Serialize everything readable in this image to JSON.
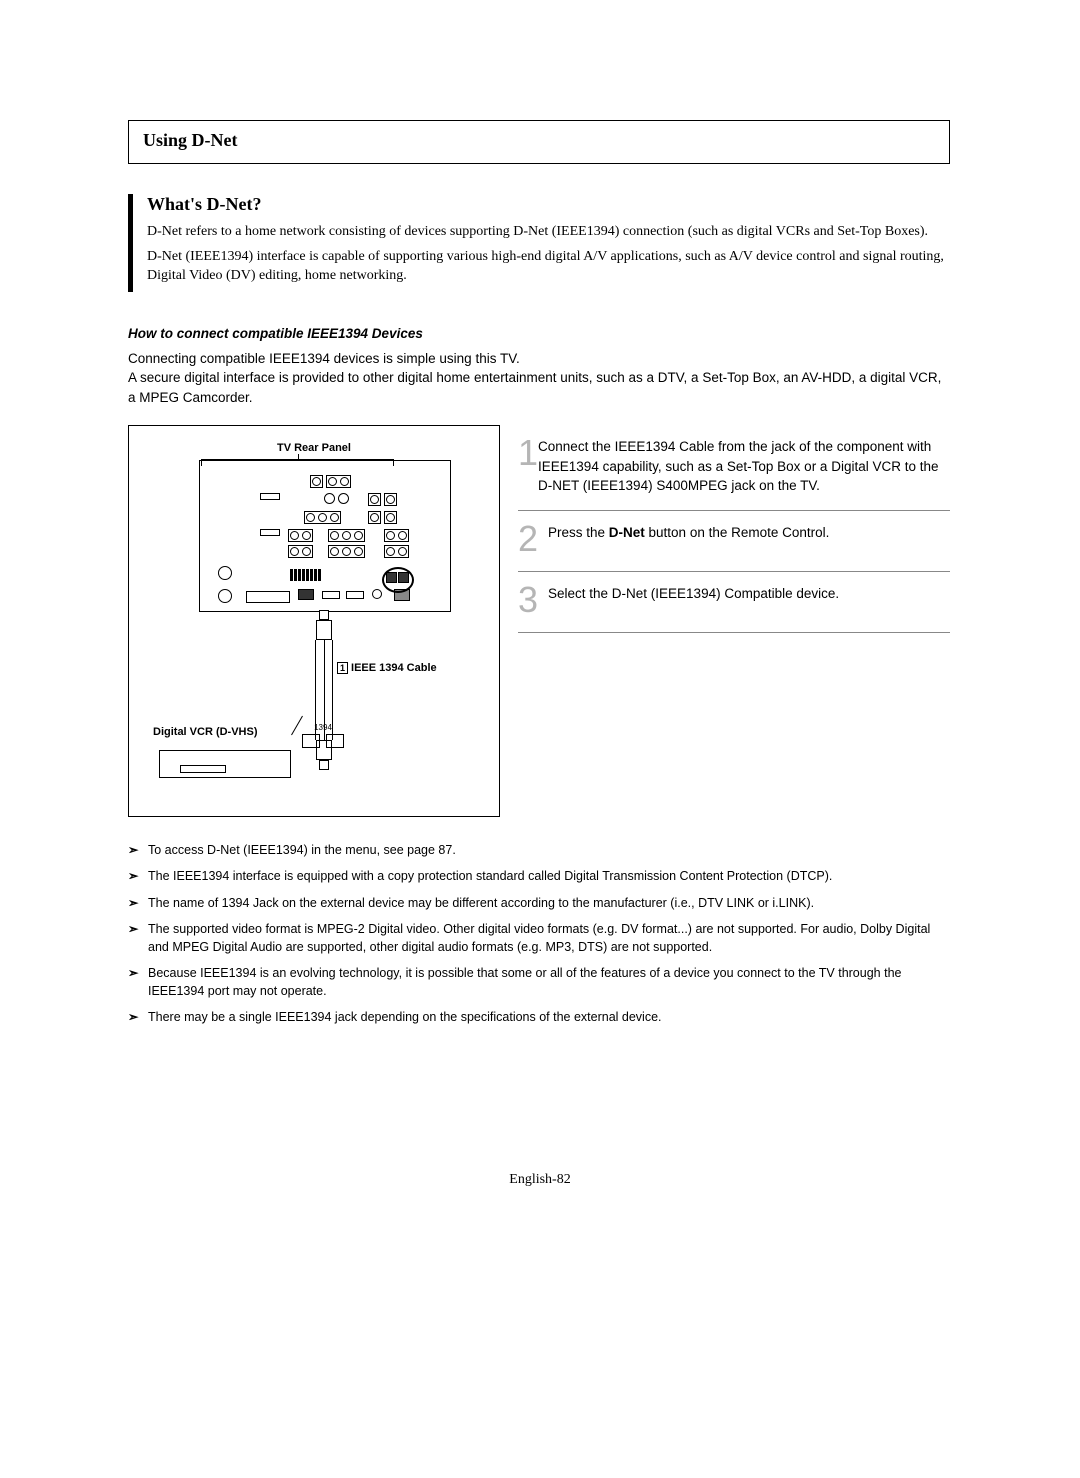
{
  "title": "Using D-Net",
  "section": {
    "heading": "What's D-Net?",
    "para1": "D-Net refers to a home network consisting of devices supporting D-Net (IEEE1394) connection (such as digital VCRs and Set-Top Boxes).",
    "para2": "D-Net (IEEE1394) interface is capable of supporting various high-end digital A/V applications, such as A/V device control and signal routing, Digital Video (DV) editing, home networking."
  },
  "howto": {
    "heading": "How to connect compatible IEEE1394 Devices",
    "intro": "Connecting compatible IEEE1394 devices is simple using this TV.\nA secure digital interface is provided to other digital home entertainment units, such as a DTV, a Set-Top Box, an AV-HDD, a digital VCR, a MPEG Camcorder."
  },
  "diagram": {
    "panel_title": "TV Rear Panel",
    "cable_num": "1",
    "cable_label": "IEEE 1394 Cable",
    "vcr_label": "Digital VCR (D-VHS)",
    "port_1394": "1394"
  },
  "steps": [
    {
      "num": "1",
      "text": "Connect the IEEE1394 Cable from the jack of the component with IEEE1394 capability, such as a Set-Top Box or a Digital VCR to the D-NET (IEEE1394) S400MPEG jack on the TV."
    },
    {
      "num": "2",
      "text_pre": "Press the ",
      "text_bold": "D-Net",
      "text_post": " button on the Remote Control."
    },
    {
      "num": "3",
      "text": "Select the D-Net (IEEE1394) Compatible device."
    }
  ],
  "notes": [
    "To access D-Net (IEEE1394) in the menu, see page 87.",
    "The IEEE1394 interface is equipped with a copy protection standard called Digital Transmission Content Protection (DTCP).",
    "The name of 1394 Jack on the external device may be different according to the manufacturer (i.e., DTV LINK or i.LINK).",
    "The supported video format is MPEG-2 Digital video. Other digital video formats (e.g. DV format...) are not supported. For audio, Dolby Digital and MPEG Digital Audio are supported, other digital audio formats (e.g. MP3, DTS) are not supported.",
    "Because IEEE1394 is an evolving technology, it is possible that some or all of the features of a device you connect to the TV through the IEEE1394 port may not operate.",
    "There may be a single IEEE1394 jack depending on the specifications of the external device."
  ],
  "footer": "English-82"
}
